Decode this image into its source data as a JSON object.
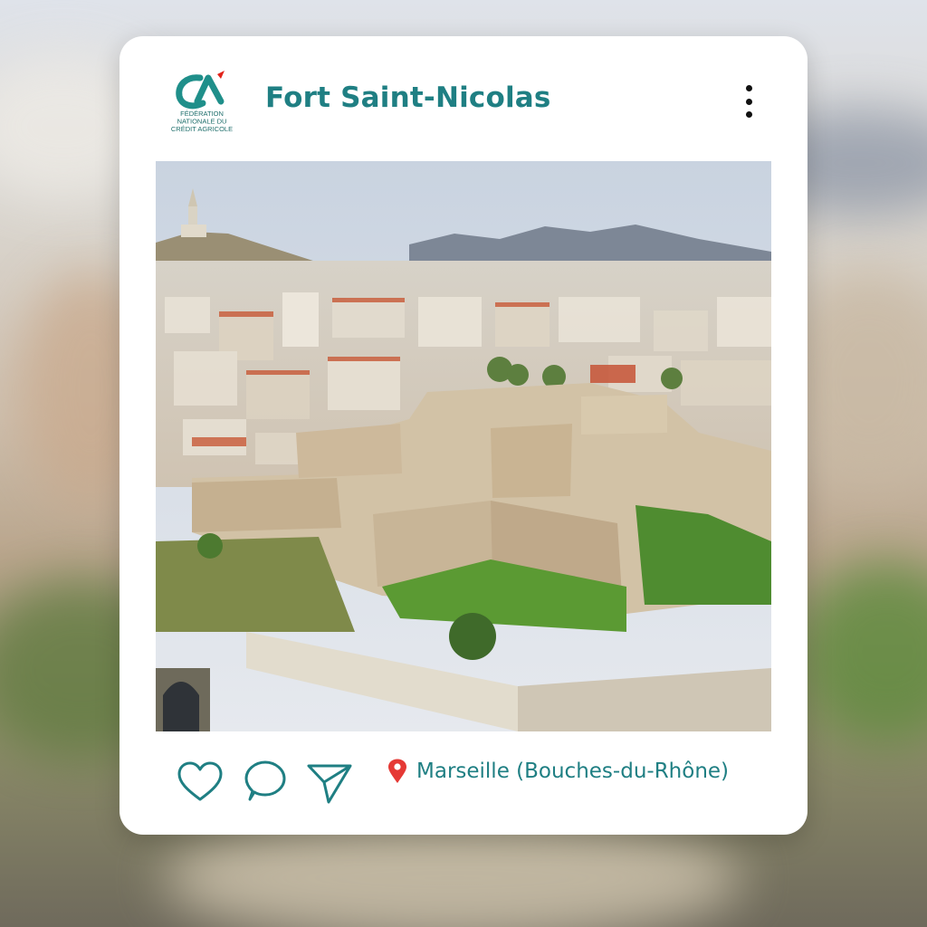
{
  "post": {
    "title": "Fort Saint-Nicolas",
    "location": "Marseille (Bouches-du-Rhône)"
  },
  "logo": {
    "lines": [
      "FÉDÉRATION",
      "NATIONALE DU",
      "CRÉDIT AGRICOLE"
    ],
    "colors": {
      "teal": "#1f8f8a",
      "red": "#e2231a"
    }
  },
  "icons": {
    "more": "more-vertical-icon",
    "like": "heart-icon",
    "comment": "comment-bubble-icon",
    "share": "paper-plane-icon",
    "location": "map-pin-icon"
  },
  "colors": {
    "accent": "#1f7f83",
    "pin": "#e53935",
    "card": "#ffffff"
  }
}
